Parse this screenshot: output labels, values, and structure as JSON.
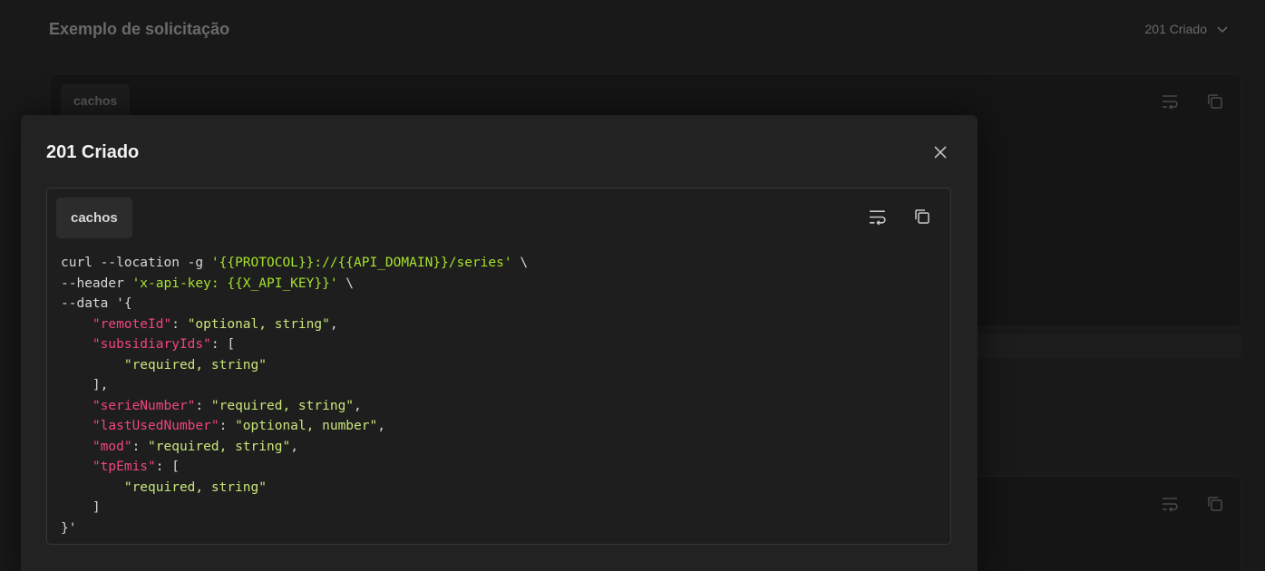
{
  "background": {
    "title": "Exemplo de solicitação",
    "status": "201 Criado",
    "tab_label": "cachos"
  },
  "modal": {
    "title": "201 Criado",
    "tab_label": "cachos",
    "code_lines": [
      [
        {
          "t": "plain",
          "v": "curl --location -g "
        },
        {
          "t": "str",
          "v": "'{{PROTOCOL}}://{{API_DOMAIN}}/series'"
        },
        {
          "t": "plain",
          "v": " \\"
        }
      ],
      [
        {
          "t": "plain",
          "v": "--header "
        },
        {
          "t": "str",
          "v": "'x-api-key: {{X_API_KEY}}'"
        },
        {
          "t": "plain",
          "v": " \\"
        }
      ],
      [
        {
          "t": "plain",
          "v": "--data '{"
        }
      ],
      [
        {
          "t": "plain",
          "v": "    "
        },
        {
          "t": "key",
          "v": "\"remoteId\""
        },
        {
          "t": "plain",
          "v": ": "
        },
        {
          "t": "val",
          "v": "\"optional, string\""
        },
        {
          "t": "plain",
          "v": ","
        }
      ],
      [
        {
          "t": "plain",
          "v": "    "
        },
        {
          "t": "key",
          "v": "\"subsidiaryIds\""
        },
        {
          "t": "plain",
          "v": ": ["
        }
      ],
      [
        {
          "t": "plain",
          "v": "        "
        },
        {
          "t": "val",
          "v": "\"required, string\""
        }
      ],
      [
        {
          "t": "plain",
          "v": "    ],"
        }
      ],
      [
        {
          "t": "plain",
          "v": "    "
        },
        {
          "t": "key",
          "v": "\"serieNumber\""
        },
        {
          "t": "plain",
          "v": ": "
        },
        {
          "t": "val",
          "v": "\"required, string\""
        },
        {
          "t": "plain",
          "v": ","
        }
      ],
      [
        {
          "t": "plain",
          "v": "    "
        },
        {
          "t": "key",
          "v": "\"lastUsedNumber\""
        },
        {
          "t": "plain",
          "v": ": "
        },
        {
          "t": "val",
          "v": "\"optional, number\""
        },
        {
          "t": "plain",
          "v": ","
        }
      ],
      [
        {
          "t": "plain",
          "v": "    "
        },
        {
          "t": "key",
          "v": "\"mod\""
        },
        {
          "t": "plain",
          "v": ": "
        },
        {
          "t": "val",
          "v": "\"required, string\""
        },
        {
          "t": "plain",
          "v": ","
        }
      ],
      [
        {
          "t": "plain",
          "v": "    "
        },
        {
          "t": "key",
          "v": "\"tpEmis\""
        },
        {
          "t": "plain",
          "v": ": ["
        }
      ],
      [
        {
          "t": "plain",
          "v": "        "
        },
        {
          "t": "val",
          "v": "\"required, string\""
        }
      ],
      [
        {
          "t": "plain",
          "v": "    ]"
        }
      ],
      [
        {
          "t": "plain",
          "v": "}'"
        }
      ]
    ]
  },
  "colors": {
    "accent_key": "#f0457f",
    "accent_string": "#a6e22e"
  }
}
